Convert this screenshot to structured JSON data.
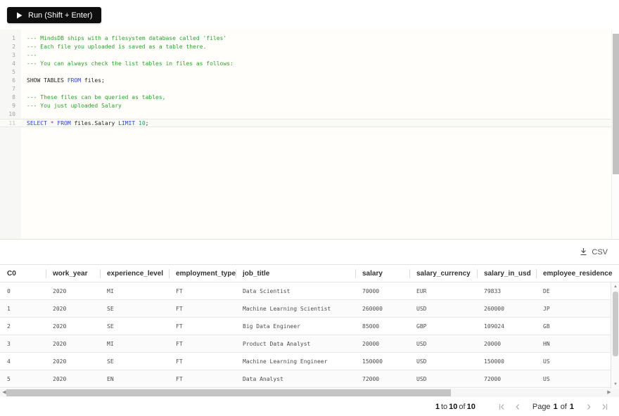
{
  "colors": {
    "run_button_bg": "#0e0e0e",
    "syntax_comment": "#2fa12f",
    "syntax_keyword": "#2946d6",
    "syntax_star": "#a62ca6",
    "syntax_number": "#17a36b",
    "gutter_bg": "#f7f7f6",
    "divider": "#e2e2e2",
    "scroll_thumb": "#c4c4c4"
  },
  "toolbar": {
    "run_label": "Run (Shift + Enter)"
  },
  "editor": {
    "lines": [
      {
        "n": "1",
        "segments": [
          [
            "comment",
            "--- MindsDB ships with a filesystem database called 'files'"
          ]
        ]
      },
      {
        "n": "2",
        "segments": [
          [
            "comment",
            "--- Each file you uploaded is saved as a table there."
          ]
        ]
      },
      {
        "n": "3",
        "segments": [
          [
            "comment",
            "---"
          ]
        ]
      },
      {
        "n": "4",
        "segments": [
          [
            "comment",
            "--- You can always check the list tables in files as follows:"
          ]
        ]
      },
      {
        "n": "5",
        "segments": []
      },
      {
        "n": "6",
        "segments": [
          [
            "plain",
            "SHOW TABLES "
          ],
          [
            "keyword",
            "FROM"
          ],
          [
            "plain",
            " files;"
          ]
        ]
      },
      {
        "n": "7",
        "segments": []
      },
      {
        "n": "8",
        "segments": [
          [
            "comment",
            "--- These files can be queried as tables,"
          ]
        ]
      },
      {
        "n": "9",
        "segments": [
          [
            "comment",
            "--- You just uploaded Salary"
          ]
        ]
      },
      {
        "n": "10",
        "segments": []
      },
      {
        "n": "11",
        "active": true,
        "segments": [
          [
            "keyword",
            "SELECT"
          ],
          [
            "plain",
            " "
          ],
          [
            "star",
            "*"
          ],
          [
            "plain",
            " "
          ],
          [
            "keyword",
            "FROM"
          ],
          [
            "plain",
            " files.Salary "
          ],
          [
            "keyword",
            "LIMIT"
          ],
          [
            "plain",
            " "
          ],
          [
            "number",
            "10"
          ],
          [
            "plain",
            ";"
          ]
        ]
      }
    ]
  },
  "results": {
    "csv_label": "CSV",
    "table": {
      "columns": [
        "C0",
        "work_year",
        "experience_level",
        "employment_type",
        "job_title",
        "salary",
        "salary_currency",
        "salary_in_usd",
        "employee_residence"
      ],
      "rows": [
        [
          "0",
          "2020",
          "MI",
          "FT",
          "Data Scientist",
          "70000",
          "EUR",
          "79833",
          "DE"
        ],
        [
          "1",
          "2020",
          "SE",
          "FT",
          "Machine Learning Scientist",
          "260000",
          "USD",
          "260000",
          "JP"
        ],
        [
          "2",
          "2020",
          "SE",
          "FT",
          "Big Data Engineer",
          "85000",
          "GBP",
          "109024",
          "GB"
        ],
        [
          "3",
          "2020",
          "MI",
          "FT",
          "Product Data Analyst",
          "20000",
          "USD",
          "20000",
          "HN"
        ],
        [
          "4",
          "2020",
          "SE",
          "FT",
          "Machine Learning Engineer",
          "150000",
          "USD",
          "150000",
          "US"
        ],
        [
          "5",
          "2020",
          "EN",
          "FT",
          "Data Analyst",
          "72000",
          "USD",
          "72000",
          "US"
        ]
      ]
    },
    "footer": {
      "range_from": "1",
      "to_word": "to",
      "range_to": "10",
      "of_word": "of",
      "range_total": "10",
      "page_word": "Page",
      "page_current": "1",
      "page_of_word": "of",
      "page_total": "1"
    }
  }
}
